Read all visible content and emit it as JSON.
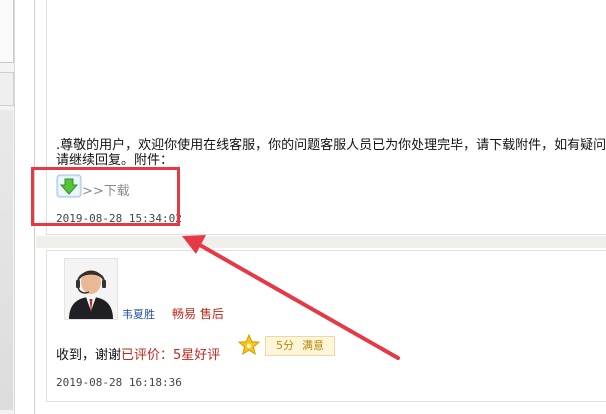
{
  "first_message": {
    "text": ".尊敬的用户，欢迎你使用在线客服，你的问题客服人员已为你处理完毕，请下载附件，如有疑问请继续回复。附件：",
    "download_label": ">>下载",
    "timestamp": "2019-08-28 15:34:02"
  },
  "second_message": {
    "agent_name": "韦夏胜",
    "agent_team": "畅易 售后",
    "reply_text": "收到，谢谢",
    "rated_text": "已评价：5星好评",
    "rating_score": "5分",
    "rating_label": "满意",
    "timestamp": "2019-08-28 16:18:36"
  },
  "left_panel": {
    "dots": "..."
  },
  "icons": {
    "download": "download-arrow-icon",
    "star": "star-icon",
    "avatar": "agent-avatar"
  },
  "colors": {
    "highlight": "#e63946",
    "agent_name": "#1f4ea8",
    "accent_red": "#c0261d",
    "badge_bg": "#fff6da"
  }
}
